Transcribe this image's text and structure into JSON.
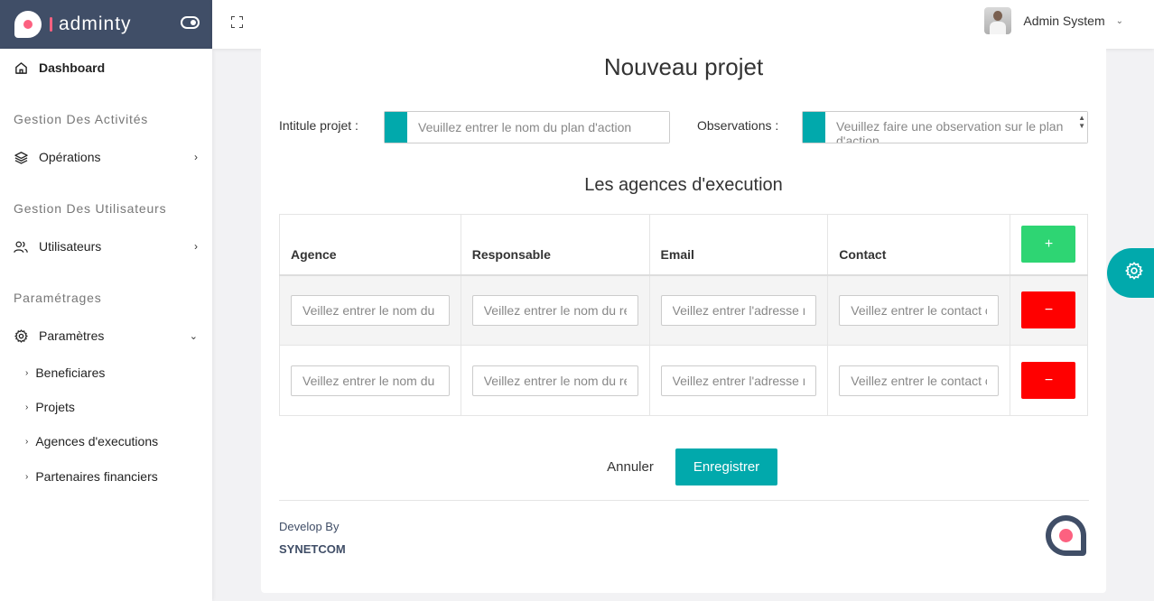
{
  "brand": {
    "name": "adminty"
  },
  "header": {
    "user_name": "Admin System"
  },
  "sidebar": {
    "dashboard": "Dashboard",
    "section_activities": "Gestion Des Activités",
    "operations": "Opérations",
    "section_users": "Gestion Des Utilisateurs",
    "users": "Utilisateurs",
    "section_settings": "Paramétrages",
    "settings": "Paramètres",
    "sub_items": [
      "Beneficiares",
      "Projets",
      "Agences d'executions",
      "Partenaires financiers"
    ]
  },
  "page": {
    "title": "Nouveau projet",
    "intitule_label": "Intitule projet :",
    "intitule_placeholder": "Veuillez entrer le nom du plan d'action",
    "observations_label": "Observations :",
    "observations_placeholder": "Veuillez faire une observation sur le plan d'action",
    "agencies_title": "Les agences d'execution"
  },
  "table": {
    "headers": [
      "Agence",
      "Responsable",
      "Email",
      "Contact"
    ],
    "add_label": "+",
    "remove_label": "−",
    "row_placeholders": [
      "Veillez entrer le nom du",
      "Veillez entrer le nom du re",
      "Veillez entrer l'adresse n",
      "Veillez entrer le contact c"
    ]
  },
  "actions": {
    "cancel": "Annuler",
    "save": "Enregistrer"
  },
  "footer": {
    "develop_by": "Develop By",
    "company": "SYNETCOM"
  },
  "colors": {
    "accent": "#01a9ac",
    "brand_dark": "#404e67",
    "add": "#2ed573",
    "remove": "#ff0000",
    "logo_dot": "#fc6180"
  }
}
